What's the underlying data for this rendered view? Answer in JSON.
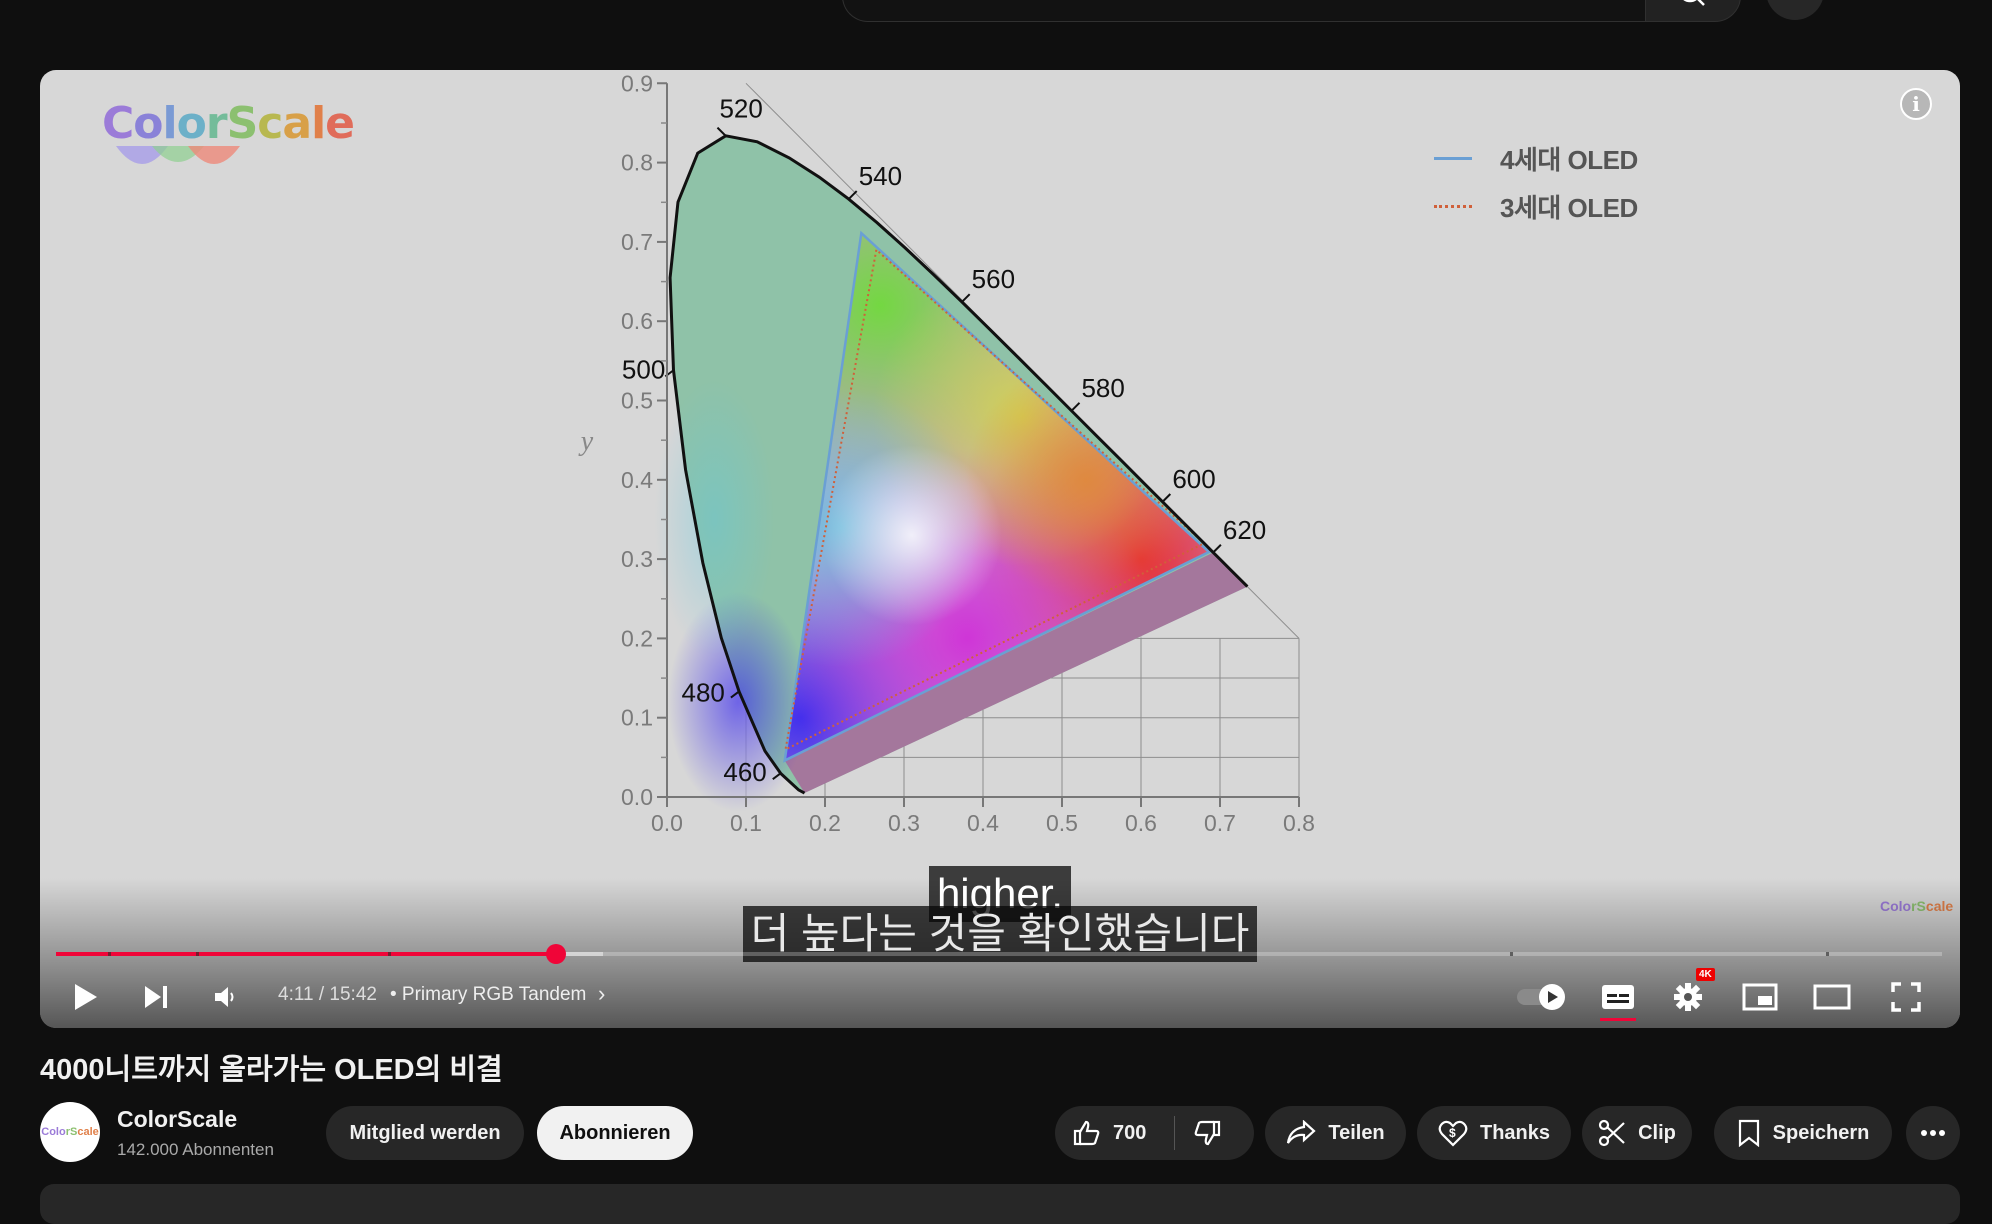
{
  "player": {
    "brand_logo": "ColorScale",
    "legend": [
      {
        "label": "4세대 OLED",
        "color": "#6a9fd4",
        "style": "solid"
      },
      {
        "label": "3세대 OLED",
        "color": "#d0603a",
        "style": "dotted"
      }
    ],
    "info_icon": "info-icon",
    "watermark": "ColorScale",
    "captions": [
      "higher.",
      "더 높다는 것을 확인했습니다"
    ],
    "progress": {
      "played_fraction": 0.265,
      "buffered_fraction": 0.29
    },
    "time": "4:11 / 15:42",
    "chapter": "• Primary RGB Tandem",
    "badge": "4K"
  },
  "chart_data": {
    "type": "scatter",
    "ylabel": "y",
    "xlim": [
      0.0,
      0.8
    ],
    "ylim": [
      0.0,
      0.9
    ],
    "x_ticks": [
      "0.0",
      "0.1",
      "0.2",
      "0.3",
      "0.4",
      "0.5",
      "0.6",
      "0.7",
      "0.8"
    ],
    "y_ticks": [
      "0.0",
      "0.1",
      "0.2",
      "0.3",
      "0.4",
      "0.5",
      "0.6",
      "0.7",
      "0.8",
      "0.9"
    ],
    "spectral_locus_labels": [
      {
        "label": "460",
        "x": 0.144,
        "y": 0.03
      },
      {
        "label": "480",
        "x": 0.091,
        "y": 0.133
      },
      {
        "label": "500",
        "x": 0.008,
        "y": 0.538
      },
      {
        "label": "520",
        "x": 0.074,
        "y": 0.834
      },
      {
        "label": "540",
        "x": 0.23,
        "y": 0.754
      },
      {
        "label": "560",
        "x": 0.373,
        "y": 0.624
      },
      {
        "label": "580",
        "x": 0.512,
        "y": 0.487
      },
      {
        "label": "600",
        "x": 0.627,
        "y": 0.372
      },
      {
        "label": "620",
        "x": 0.691,
        "y": 0.308
      }
    ],
    "series": [
      {
        "name": "4세대 OLED",
        "points": [
          [
            0.686,
            0.309
          ],
          [
            0.246,
            0.711
          ],
          [
            0.149,
            0.046
          ]
        ]
      },
      {
        "name": "3세대 OLED",
        "points": [
          [
            0.68,
            0.32
          ],
          [
            0.265,
            0.69
          ],
          [
            0.15,
            0.06
          ]
        ]
      }
    ]
  },
  "video": {
    "title": "4000니트까지 올라가는 OLED의 비결",
    "channel_name": "ColorScale",
    "subscribers": "142.000 Abonnenten",
    "avatar_text": "ColorScale"
  },
  "actions": {
    "member": "Mitglied werden",
    "subscribe": "Abonnieren",
    "likes": "700",
    "share": "Teilen",
    "thanks": "Thanks",
    "clip": "Clip",
    "save": "Speichern"
  }
}
